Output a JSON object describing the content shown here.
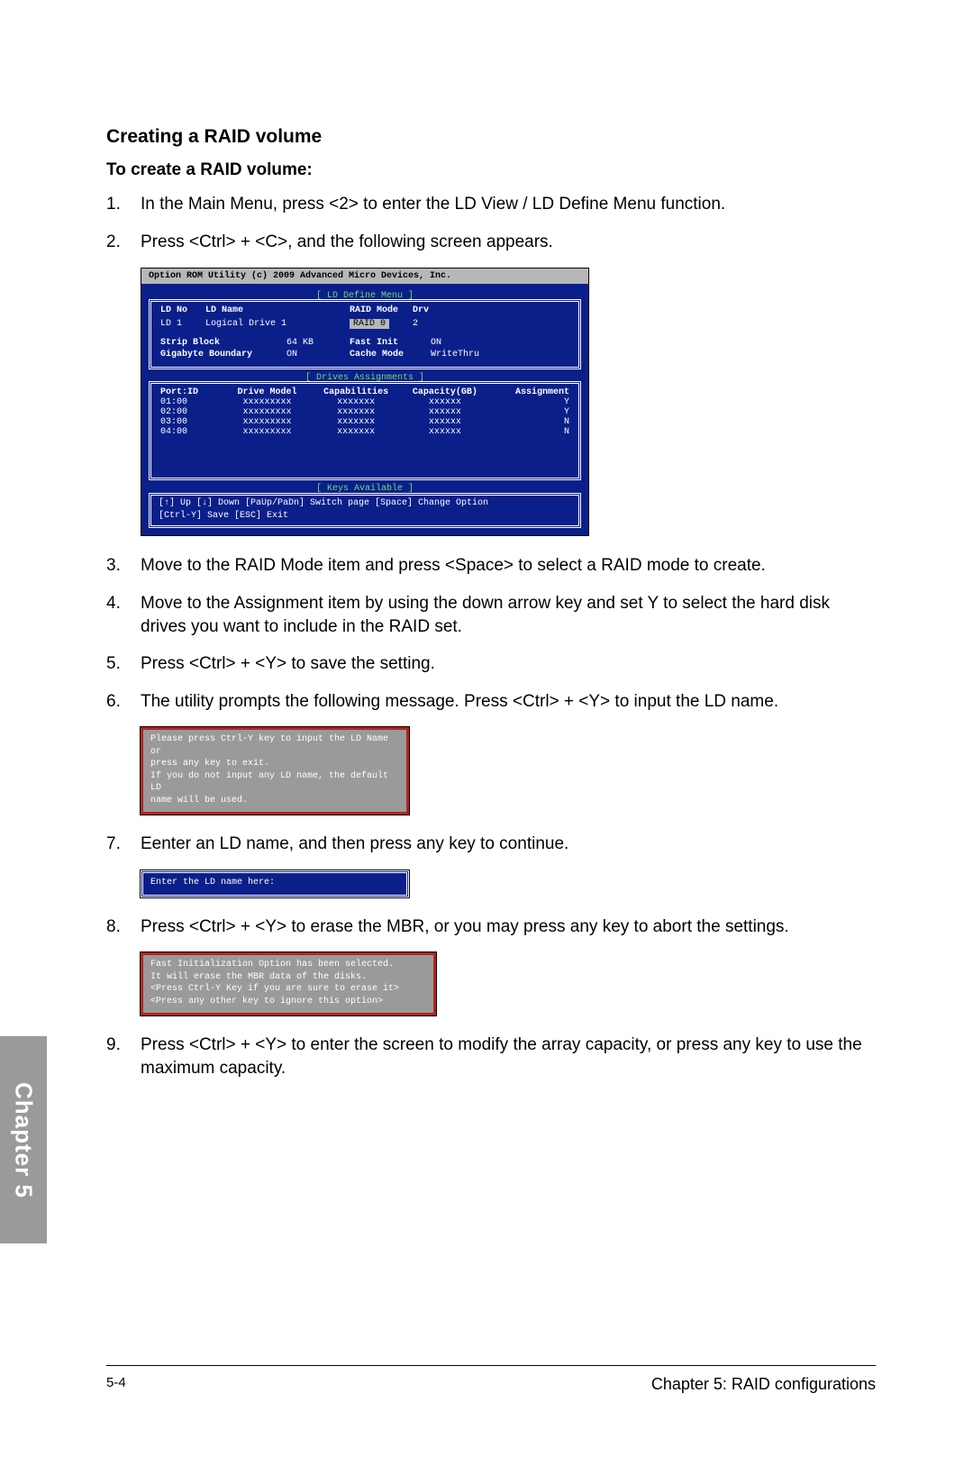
{
  "heading": "Creating a RAID volume",
  "subheading": "To create a RAID volume:",
  "steps": {
    "s1": "In the Main Menu, press <2> to enter the LD View / LD Define Menu function.",
    "s2": "Press <Ctrl> + <C>, and the following screen appears.",
    "s3": "Move to the RAID Mode item and press <Space> to select a RAID mode to create.",
    "s4": "Move to the Assignment item by using the down arrow key and set Y to select the hard disk drives you want to include in the RAID set.",
    "s5": "Press <Ctrl> + <Y> to save the setting.",
    "s6": "The utility prompts the following message. Press <Ctrl> + <Y> to input the LD name.",
    "s7": "Eenter an LD name, and then press any key to continue.",
    "s8": "Press <Ctrl> + <Y> to erase the MBR, or you may press any key to abort the settings.",
    "s9": "Press <Ctrl> + <Y> to enter the screen to modify the array capacity, or press any key to use the maximum capacity."
  },
  "bios": {
    "title": "Option ROM Utility (c) 2009 Advanced Micro Devices, Inc.",
    "define_label": "[ LD Define Menu ]",
    "ld_header": {
      "c1": "LD No",
      "c2": "LD Name",
      "c3": "RAID Mode",
      "c4": "Drv"
    },
    "ld_row": {
      "c1": "LD  1",
      "c2": "Logical Drive 1",
      "c3": "RAID 0",
      "c4": "2"
    },
    "settings": {
      "r1": {
        "a": "Strip Block",
        "b": "64 KB",
        "c": "Fast Init",
        "d": "ON"
      },
      "r2": {
        "a": "Gigabyte Boundary",
        "b": "ON",
        "c": "Cache Mode",
        "d": "WriteThru"
      }
    },
    "drives_label": "[ Drives Assignments ]",
    "drives_header": {
      "c1": "Port:ID",
      "c2": "Drive Model",
      "c3": "Capabilities",
      "c4": "Capacity(GB)",
      "c5": "Assignment"
    },
    "drives": [
      {
        "c1": "01:00",
        "c2": "xxxxxxxxx",
        "c3": "xxxxxxx",
        "c4": "xxxxxx",
        "c5": "Y"
      },
      {
        "c1": "02:00",
        "c2": "xxxxxxxxx",
        "c3": "xxxxxxx",
        "c4": "xxxxxx",
        "c5": "Y"
      },
      {
        "c1": "03:00",
        "c2": "xxxxxxxxx",
        "c3": "xxxxxxx",
        "c4": "xxxxxx",
        "c5": "N"
      },
      {
        "c1": "04:00",
        "c2": "xxxxxxxxx",
        "c3": "xxxxxxx",
        "c4": "xxxxxx",
        "c5": "N"
      }
    ],
    "keys_label": "[ Keys Available ]",
    "keys_line1": "[↑] Up  [↓] Down  [PaUp/PaDn] Switch page  [Space] Change Option",
    "keys_line2": "[Ctrl-Y] Save  [ESC] Exit"
  },
  "dialog1": {
    "l1": "Please press Ctrl-Y key to input the LD Name or",
    "l2": "press any key to exit.",
    "l3": "If you do not input any LD name, the default LD",
    "l4": "name will be used."
  },
  "dialog2": "Enter the LD name here:",
  "dialog3": {
    "l1": "Fast Initialization Option has been selected.",
    "l2": "It will erase the MBR data of the disks.",
    "l3": "<Press Ctrl-Y Key if you are sure to erase it>",
    "l4": "<Press any other key to ignore this option>"
  },
  "chapter_tab": "Chapter 5",
  "footer": {
    "page": "5-4",
    "chapter": "Chapter 5: RAID configurations"
  }
}
